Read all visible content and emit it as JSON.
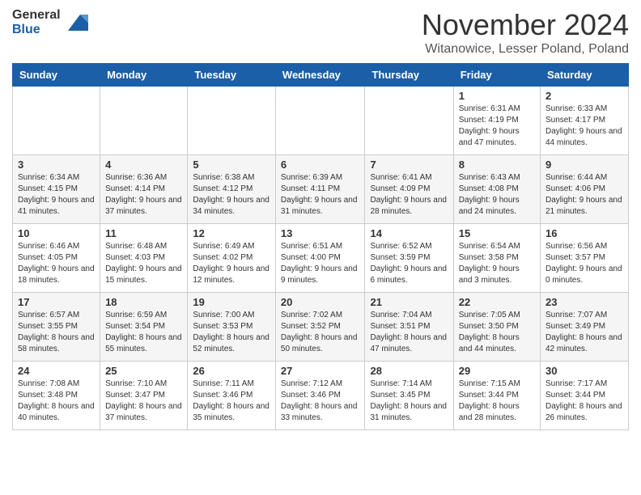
{
  "header": {
    "logo_general": "General",
    "logo_blue": "Blue",
    "month_title": "November 2024",
    "location": "Witanowice, Lesser Poland, Poland"
  },
  "days_of_week": [
    "Sunday",
    "Monday",
    "Tuesday",
    "Wednesday",
    "Thursday",
    "Friday",
    "Saturday"
  ],
  "weeks": [
    [
      {
        "day": "",
        "info": ""
      },
      {
        "day": "",
        "info": ""
      },
      {
        "day": "",
        "info": ""
      },
      {
        "day": "",
        "info": ""
      },
      {
        "day": "",
        "info": ""
      },
      {
        "day": "1",
        "info": "Sunrise: 6:31 AM\nSunset: 4:19 PM\nDaylight: 9 hours and 47 minutes."
      },
      {
        "day": "2",
        "info": "Sunrise: 6:33 AM\nSunset: 4:17 PM\nDaylight: 9 hours and 44 minutes."
      }
    ],
    [
      {
        "day": "3",
        "info": "Sunrise: 6:34 AM\nSunset: 4:15 PM\nDaylight: 9 hours and 41 minutes."
      },
      {
        "day": "4",
        "info": "Sunrise: 6:36 AM\nSunset: 4:14 PM\nDaylight: 9 hours and 37 minutes."
      },
      {
        "day": "5",
        "info": "Sunrise: 6:38 AM\nSunset: 4:12 PM\nDaylight: 9 hours and 34 minutes."
      },
      {
        "day": "6",
        "info": "Sunrise: 6:39 AM\nSunset: 4:11 PM\nDaylight: 9 hours and 31 minutes."
      },
      {
        "day": "7",
        "info": "Sunrise: 6:41 AM\nSunset: 4:09 PM\nDaylight: 9 hours and 28 minutes."
      },
      {
        "day": "8",
        "info": "Sunrise: 6:43 AM\nSunset: 4:08 PM\nDaylight: 9 hours and 24 minutes."
      },
      {
        "day": "9",
        "info": "Sunrise: 6:44 AM\nSunset: 4:06 PM\nDaylight: 9 hours and 21 minutes."
      }
    ],
    [
      {
        "day": "10",
        "info": "Sunrise: 6:46 AM\nSunset: 4:05 PM\nDaylight: 9 hours and 18 minutes."
      },
      {
        "day": "11",
        "info": "Sunrise: 6:48 AM\nSunset: 4:03 PM\nDaylight: 9 hours and 15 minutes."
      },
      {
        "day": "12",
        "info": "Sunrise: 6:49 AM\nSunset: 4:02 PM\nDaylight: 9 hours and 12 minutes."
      },
      {
        "day": "13",
        "info": "Sunrise: 6:51 AM\nSunset: 4:00 PM\nDaylight: 9 hours and 9 minutes."
      },
      {
        "day": "14",
        "info": "Sunrise: 6:52 AM\nSunset: 3:59 PM\nDaylight: 9 hours and 6 minutes."
      },
      {
        "day": "15",
        "info": "Sunrise: 6:54 AM\nSunset: 3:58 PM\nDaylight: 9 hours and 3 minutes."
      },
      {
        "day": "16",
        "info": "Sunrise: 6:56 AM\nSunset: 3:57 PM\nDaylight: 9 hours and 0 minutes."
      }
    ],
    [
      {
        "day": "17",
        "info": "Sunrise: 6:57 AM\nSunset: 3:55 PM\nDaylight: 8 hours and 58 minutes."
      },
      {
        "day": "18",
        "info": "Sunrise: 6:59 AM\nSunset: 3:54 PM\nDaylight: 8 hours and 55 minutes."
      },
      {
        "day": "19",
        "info": "Sunrise: 7:00 AM\nSunset: 3:53 PM\nDaylight: 8 hours and 52 minutes."
      },
      {
        "day": "20",
        "info": "Sunrise: 7:02 AM\nSunset: 3:52 PM\nDaylight: 8 hours and 50 minutes."
      },
      {
        "day": "21",
        "info": "Sunrise: 7:04 AM\nSunset: 3:51 PM\nDaylight: 8 hours and 47 minutes."
      },
      {
        "day": "22",
        "info": "Sunrise: 7:05 AM\nSunset: 3:50 PM\nDaylight: 8 hours and 44 minutes."
      },
      {
        "day": "23",
        "info": "Sunrise: 7:07 AM\nSunset: 3:49 PM\nDaylight: 8 hours and 42 minutes."
      }
    ],
    [
      {
        "day": "24",
        "info": "Sunrise: 7:08 AM\nSunset: 3:48 PM\nDaylight: 8 hours and 40 minutes."
      },
      {
        "day": "25",
        "info": "Sunrise: 7:10 AM\nSunset: 3:47 PM\nDaylight: 8 hours and 37 minutes."
      },
      {
        "day": "26",
        "info": "Sunrise: 7:11 AM\nSunset: 3:46 PM\nDaylight: 8 hours and 35 minutes."
      },
      {
        "day": "27",
        "info": "Sunrise: 7:12 AM\nSunset: 3:46 PM\nDaylight: 8 hours and 33 minutes."
      },
      {
        "day": "28",
        "info": "Sunrise: 7:14 AM\nSunset: 3:45 PM\nDaylight: 8 hours and 31 minutes."
      },
      {
        "day": "29",
        "info": "Sunrise: 7:15 AM\nSunset: 3:44 PM\nDaylight: 8 hours and 28 minutes."
      },
      {
        "day": "30",
        "info": "Sunrise: 7:17 AM\nSunset: 3:44 PM\nDaylight: 8 hours and 26 minutes."
      }
    ]
  ]
}
